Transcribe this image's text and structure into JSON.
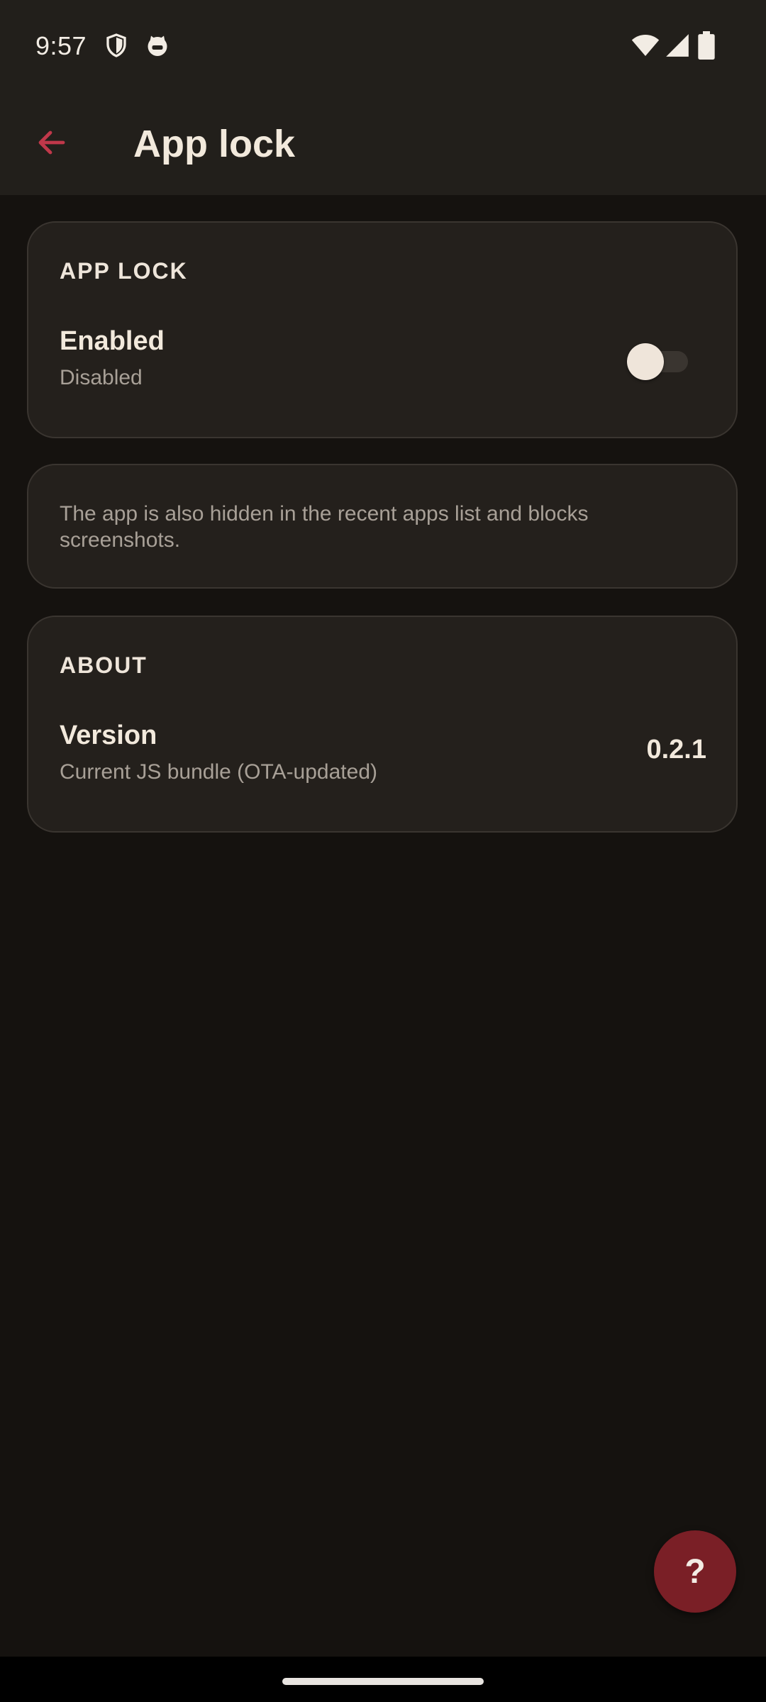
{
  "status_bar": {
    "time": "9:57",
    "left_icons": [
      "shield-icon",
      "cat-face-icon"
    ],
    "right_icons": [
      "wifi-icon",
      "cellular-signal-icon",
      "battery-icon"
    ]
  },
  "app_bar": {
    "back_icon": "arrow-left-icon",
    "title": "App lock"
  },
  "sections": {
    "app_lock": {
      "heading": "APP LOCK",
      "enabled_row": {
        "title": "Enabled",
        "subtitle": "Disabled",
        "toggle_on": false
      }
    },
    "info": {
      "text": "The app is also hidden in the recent apps list and blocks screenshots."
    },
    "about": {
      "heading": "ABOUT",
      "version_row": {
        "title": "Version",
        "subtitle": "Current JS bundle (OTA-updated)",
        "value": "0.2.1"
      }
    }
  },
  "fab": {
    "label": "?",
    "icon": "help-icon"
  },
  "colors": {
    "background": "#15120f",
    "surface": "#24201c",
    "accent": "#c0384a",
    "fab": "#7a1f26"
  }
}
